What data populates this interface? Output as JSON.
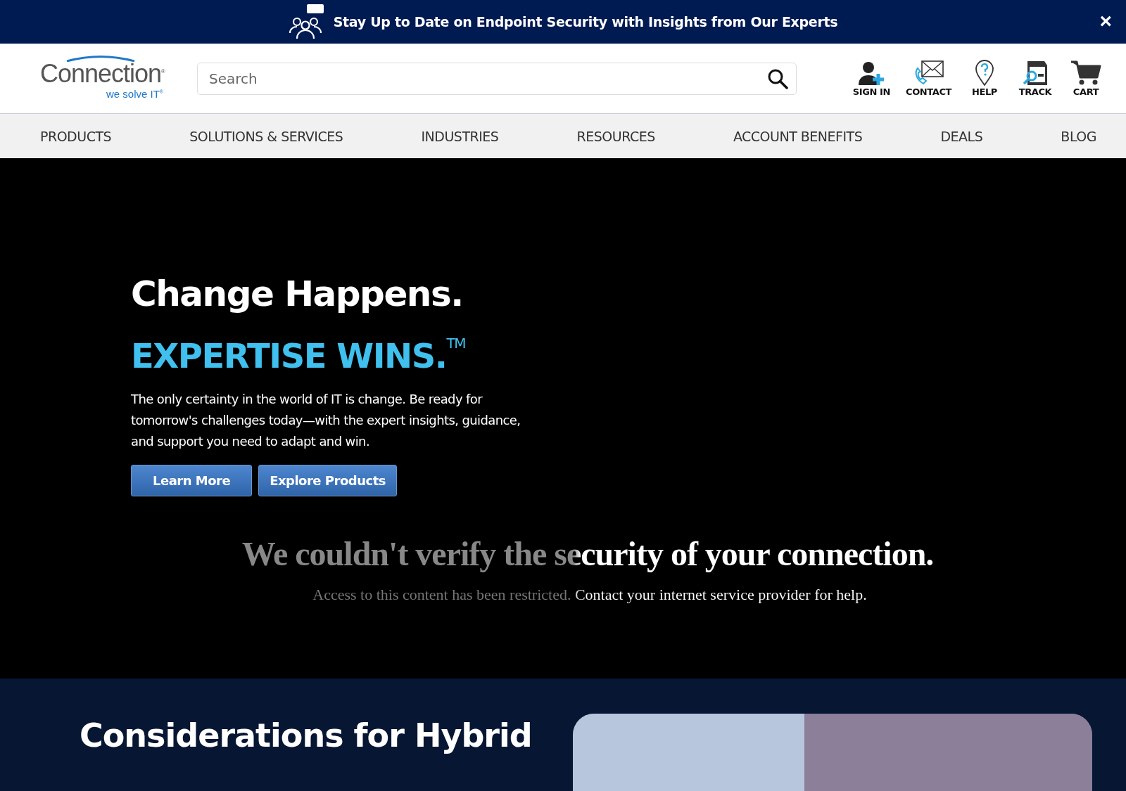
{
  "promo_banner": {
    "text": "Stay Up to Date on Endpoint Security with Insights from Our Experts",
    "close": "×"
  },
  "header": {
    "logo": {
      "name": "Connection",
      "tagline": "we solve IT",
      "mark": "®"
    },
    "search": {
      "placeholder": "Search"
    },
    "actions": [
      {
        "kind": "signin",
        "label": "SIGN IN"
      },
      {
        "kind": "contact",
        "label": "CONTACT"
      },
      {
        "kind": "help",
        "label": "HELP"
      },
      {
        "kind": "track",
        "label": "TRACK"
      },
      {
        "kind": "cart",
        "label": "CART"
      }
    ]
  },
  "nav": [
    "PRODUCTS",
    "SOLUTIONS & SERVICES",
    "INDUSTRIES",
    "RESOURCES",
    "ACCOUNT BENEFITS",
    "DEALS",
    "BLOG"
  ],
  "hero": {
    "title": "Change Happens.",
    "subtitle": "EXPERTISE WINS.$^{TM}$",
    "body": "The only certainty in the world of IT is change. Be ready for tomorrow's challenges today—with the expert insights, guidance, and support you need to adapt and win.",
    "buttons": [
      "Learn More",
      "Explore Products"
    ]
  },
  "block_notice": {
    "heading": "We couldn't verify the security of your connection.",
    "message": "Access to this content has been restricted. Contact your internet service provider for help."
  },
  "feature": {
    "heading": "Considerations for Hybrid"
  }
}
